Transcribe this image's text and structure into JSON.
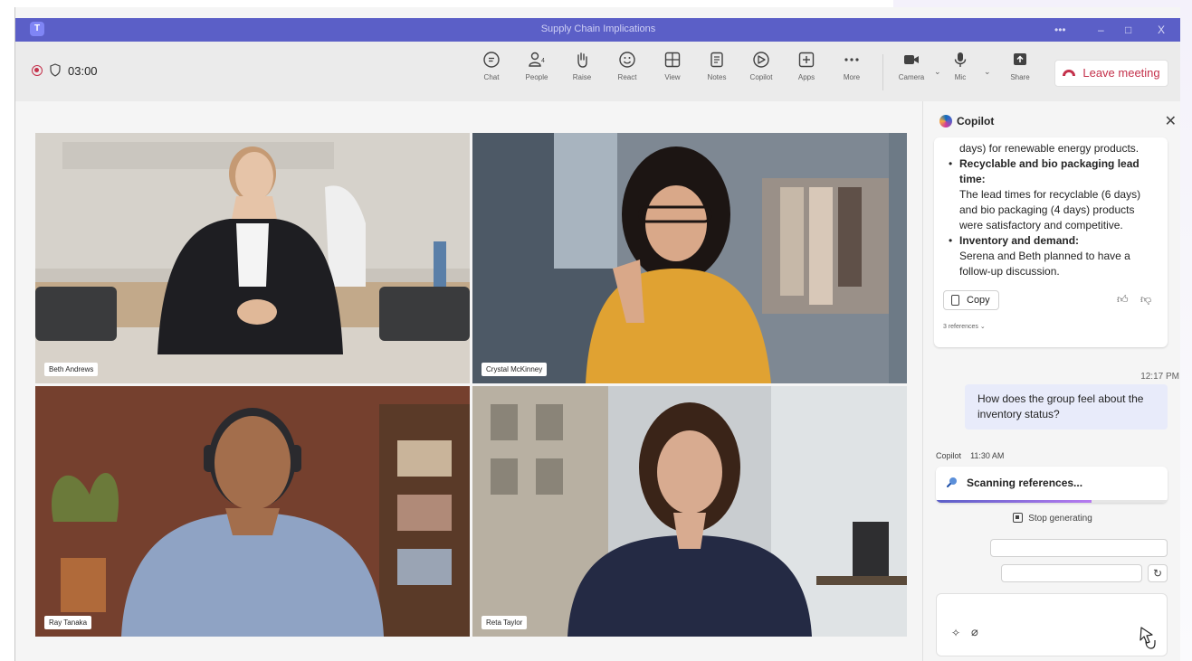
{
  "window": {
    "title": "Supply Chain Implications",
    "controls": [
      "•••",
      "–",
      "□",
      "X"
    ]
  },
  "toolbar": {
    "timer": "03:00",
    "buttons": [
      {
        "label": "Chat",
        "icon": "chat-icon"
      },
      {
        "label": "People",
        "icon": "people-icon",
        "badge": "4"
      },
      {
        "label": "Raise",
        "icon": "hand-icon"
      },
      {
        "label": "React",
        "icon": "smile-icon"
      },
      {
        "label": "View",
        "icon": "grid-icon"
      },
      {
        "label": "Notes",
        "icon": "notes-icon"
      },
      {
        "label": "Copilot",
        "icon": "copilot-icon"
      },
      {
        "label": "Apps",
        "icon": "plus-icon"
      },
      {
        "label": "More",
        "icon": "more-icon"
      },
      {
        "label": "Camera",
        "icon": "camera-icon"
      },
      {
        "label": "Mic",
        "icon": "mic-icon"
      },
      {
        "label": "Share",
        "icon": "share-icon"
      }
    ],
    "leave_label": "Leave meeting"
  },
  "participants": [
    {
      "name": "Beth Andrews"
    },
    {
      "name": "Crystal McKinney"
    },
    {
      "name": "Ray Tanaka"
    },
    {
      "name": "Reta Taylor"
    }
  ],
  "copilot": {
    "title": "Copilot",
    "card": {
      "intro": "days) for renewable energy products.",
      "items": [
        {
          "heading": "Recyclable and bio packaging lead time:",
          "text": "The lead times for recyclable (6 days) and bio packaging (4 days) products were satisfactory and competitive."
        },
        {
          "heading": "Inventory and demand:",
          "text": "Serena and Beth planned to have a follow-up discussion."
        }
      ],
      "copy_label": "Copy",
      "references": "3 references"
    },
    "user_time": "12:17 PM",
    "user_message": "How does the group feel about the inventory status?",
    "response_author": "Copilot",
    "response_time": "11:30 AM",
    "status": "Scanning references...",
    "progress": 0.67,
    "stop_label": "Stop generating"
  },
  "colors": {
    "accent": "#5b5fc7",
    "leave": "#c4314b",
    "bubble": "#e8ebfa"
  }
}
